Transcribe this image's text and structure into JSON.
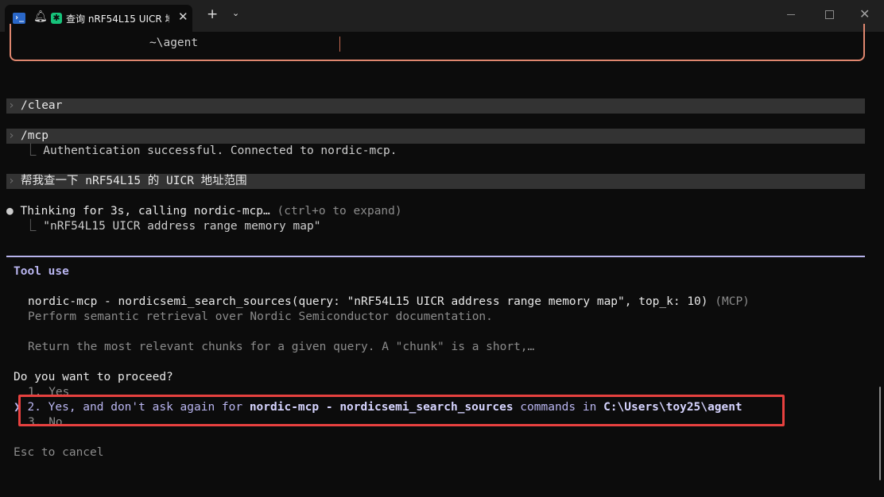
{
  "window": {
    "tab_title": "查询 nRF54L15 UICR 地",
    "icons": [
      "powershell-icon",
      "bell-icon",
      "spinner-icon",
      "close-icon",
      "plus-icon",
      "chevron-down-icon"
    ]
  },
  "header_box": {
    "path": "~\\agent"
  },
  "history": [
    {
      "prompt": "/clear"
    },
    {
      "prompt": "/mcp",
      "reply": "Authentication successful. Connected to nordic-mcp."
    },
    {
      "prompt": "帮我查一下 nRF54L15 的 UICR 地址范围"
    }
  ],
  "thinking": {
    "text": "Thinking for 3s, calling nordic-mcp…",
    "hint": "(ctrl+o to expand)",
    "query": "\"nRF54L15 UICR address range memory map\""
  },
  "tool": {
    "heading": "Tool use",
    "call": "nordic-mcp - nordicsemi_search_sources(query: \"nRF54L15 UICR address range memory map\", top_k: 10)",
    "call_tag": "(MCP)",
    "description": "Perform semantic retrieval over Nordic Semiconductor documentation.",
    "detail": "Return the most relevant chunks for a given query. A \"chunk\" is a short,…"
  },
  "prompt": {
    "question": "Do you want to proceed?",
    "options": {
      "yes": "1. Yes",
      "always_prefix": "2. Yes, and don't ask again for ",
      "always_tool": "nordic-mcp - nordicsemi_search_sources",
      "always_mid": " commands in ",
      "always_path": "C:\\Users\\toy25\\agent",
      "no": "3. No"
    },
    "cancel": "Esc to cancel"
  },
  "colors": {
    "accent": "#b9b5f0",
    "highlight": "#e7413f",
    "box": "#e0876f"
  }
}
